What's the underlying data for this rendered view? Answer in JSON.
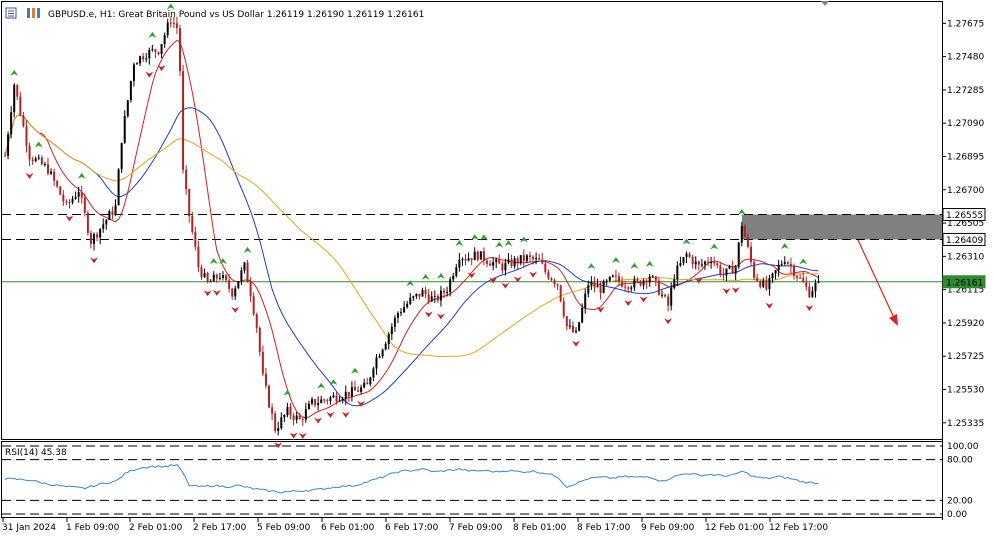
{
  "header": {
    "title": "GBPUSD.e, H1:  Great Britain Pound vs US Dollar  1.26119 1.26190 1.26119 1.26161"
  },
  "rsi": {
    "label": "RSI(14) 45.38",
    "value": 45.38,
    "levels": [
      100,
      80,
      20,
      0
    ],
    "level_labels": [
      "100.00",
      "80.00",
      "20.00",
      "0.00"
    ],
    "dashed_levels": [
      100,
      80,
      20,
      0
    ]
  },
  "price_axis": {
    "ticks": [
      "1.27675",
      "1.27480",
      "1.27285",
      "1.27090",
      "1.26895",
      "1.26700",
      "1.26505",
      "1.26310",
      "1.26115",
      "1.25920",
      "1.25725",
      "1.25530",
      "1.25335"
    ],
    "tick_values": [
      1.27675,
      1.2748,
      1.27285,
      1.2709,
      1.26895,
      1.267,
      1.26505,
      1.2631,
      1.26115,
      1.2592,
      1.25725,
      1.2553,
      1.25335
    ],
    "highlight_labels": [
      {
        "text": "1.26555",
        "value": 1.26555,
        "bg": "#ffffff",
        "border": "#000000"
      },
      {
        "text": "1.26409",
        "value": 1.26409,
        "bg": "#ffffff",
        "border": "#000000"
      },
      {
        "text": "1.26161",
        "value": 1.26161,
        "bg": "#2e8b2e",
        "border": "#2e8b2e"
      }
    ]
  },
  "time_axis": {
    "labels": [
      "31 Jan 2024",
      "1 Feb 09:00",
      "2 Feb 01:00",
      "2 Feb 17:00",
      "5 Feb 09:00",
      "6 Feb 01:00",
      "6 Feb 17:00",
      "7 Feb 09:00",
      "8 Feb 01:00",
      "8 Feb 17:00",
      "9 Feb 09:00",
      "12 Feb 01:00",
      "12 Feb 17:00"
    ]
  },
  "colors": {
    "bull": "#000000",
    "bear": "#b22222",
    "ma_fast": "#d42020",
    "ma_mid": "#1f3fbf",
    "ma_slow": "#e6a519",
    "rsi": "#3a87c8",
    "current_price_line": "#2e8b2e",
    "zone": "#808080",
    "forecast_arrow": "#e02020",
    "up_fractal": "#2aa02a",
    "down_fractal": "#d02020"
  },
  "chart_data": {
    "type": "candlestick",
    "symbol": "GBPUSD.e",
    "timeframe": "H1",
    "ylim": [
      1.2524,
      1.278
    ],
    "current_price": 1.26161,
    "resistance_zone": [
      1.26409,
      1.26555
    ],
    "dashed_levels": [
      1.26555,
      1.26409
    ],
    "close_path": [
      [
        0,
        1.269
      ],
      [
        3,
        1.2732
      ],
      [
        8,
        1.269
      ],
      [
        14,
        1.2682
      ],
      [
        20,
        1.266
      ],
      [
        24,
        1.267
      ],
      [
        28,
        1.264
      ],
      [
        32,
        1.265
      ],
      [
        36,
        1.266
      ],
      [
        38,
        1.27
      ],
      [
        42,
        1.2745
      ],
      [
        46,
        1.275
      ],
      [
        50,
        1.2752
      ],
      [
        54,
        1.277
      ],
      [
        56,
        1.2765
      ],
      [
        57,
        1.274
      ],
      [
        58,
        1.268
      ],
      [
        60,
        1.2655
      ],
      [
        63,
        1.2625
      ],
      [
        66,
        1.2615
      ],
      [
        70,
        1.262
      ],
      [
        74,
        1.261
      ],
      [
        78,
        1.2625
      ],
      [
        80,
        1.261
      ],
      [
        82,
        1.259
      ],
      [
        84,
        1.256
      ],
      [
        88,
        1.253
      ],
      [
        92,
        1.254
      ],
      [
        96,
        1.2535
      ],
      [
        100,
        1.2545
      ],
      [
        106,
        1.2548
      ],
      [
        110,
        1.255
      ],
      [
        114,
        1.2552
      ],
      [
        118,
        1.2555
      ],
      [
        120,
        1.2568
      ],
      [
        124,
        1.2582
      ],
      [
        128,
        1.2598
      ],
      [
        132,
        1.2605
      ],
      [
        136,
        1.261
      ],
      [
        140,
        1.2605
      ],
      [
        144,
        1.2612
      ],
      [
        148,
        1.2632
      ],
      [
        150,
        1.263
      ],
      [
        154,
        1.2632
      ],
      [
        158,
        1.2628
      ],
      [
        162,
        1.2625
      ],
      [
        166,
        1.2628
      ],
      [
        170,
        1.263
      ],
      [
        174,
        1.2628
      ],
      [
        176,
        1.2622
      ],
      [
        180,
        1.2615
      ],
      [
        183,
        1.259
      ],
      [
        186,
        1.2585
      ],
      [
        188,
        1.26
      ],
      [
        190,
        1.2615
      ],
      [
        194,
        1.2612
      ],
      [
        198,
        1.2618
      ],
      [
        202,
        1.2615
      ],
      [
        206,
        1.2615
      ],
      [
        210,
        1.262
      ],
      [
        214,
        1.2608
      ],
      [
        216,
        1.2602
      ],
      [
        218,
        1.262
      ],
      [
        222,
        1.2632
      ],
      [
        226,
        1.2625
      ],
      [
        230,
        1.263
      ],
      [
        234,
        1.262
      ],
      [
        238,
        1.2625
      ],
      [
        240,
        1.265
      ],
      [
        244,
        1.262
      ],
      [
        248,
        1.2612
      ],
      [
        252,
        1.2625
      ],
      [
        254,
        1.263
      ],
      [
        258,
        1.262
      ],
      [
        262,
        1.261
      ],
      [
        265,
        1.26161
      ]
    ],
    "rsi_series": [
      [
        0,
        52
      ],
      [
        8,
        50
      ],
      [
        14,
        44
      ],
      [
        20,
        40
      ],
      [
        26,
        38
      ],
      [
        32,
        45
      ],
      [
        36,
        48
      ],
      [
        40,
        62
      ],
      [
        44,
        68
      ],
      [
        48,
        70
      ],
      [
        52,
        70
      ],
      [
        56,
        72
      ],
      [
        58,
        60
      ],
      [
        60,
        42
      ],
      [
        64,
        40
      ],
      [
        68,
        42
      ],
      [
        72,
        40
      ],
      [
        76,
        42
      ],
      [
        80,
        38
      ],
      [
        84,
        35
      ],
      [
        90,
        32
      ],
      [
        96,
        34
      ],
      [
        102,
        36
      ],
      [
        108,
        40
      ],
      [
        114,
        42
      ],
      [
        120,
        50
      ],
      [
        124,
        56
      ],
      [
        128,
        62
      ],
      [
        132,
        64
      ],
      [
        136,
        66
      ],
      [
        140,
        62
      ],
      [
        144,
        64
      ],
      [
        148,
        66
      ],
      [
        152,
        63
      ],
      [
        156,
        64
      ],
      [
        160,
        62
      ],
      [
        164,
        64
      ],
      [
        168,
        62
      ],
      [
        172,
        63
      ],
      [
        176,
        60
      ],
      [
        180,
        55
      ],
      [
        183,
        40
      ],
      [
        186,
        45
      ],
      [
        190,
        52
      ],
      [
        194,
        54
      ],
      [
        198,
        53
      ],
      [
        202,
        55
      ],
      [
        206,
        54
      ],
      [
        210,
        55
      ],
      [
        214,
        48
      ],
      [
        218,
        55
      ],
      [
        222,
        60
      ],
      [
        226,
        57
      ],
      [
        230,
        58
      ],
      [
        234,
        56
      ],
      [
        238,
        58
      ],
      [
        240,
        63
      ],
      [
        244,
        55
      ],
      [
        248,
        52
      ],
      [
        252,
        55
      ],
      [
        256,
        52
      ],
      [
        260,
        47
      ],
      [
        265,
        45.38
      ]
    ]
  }
}
